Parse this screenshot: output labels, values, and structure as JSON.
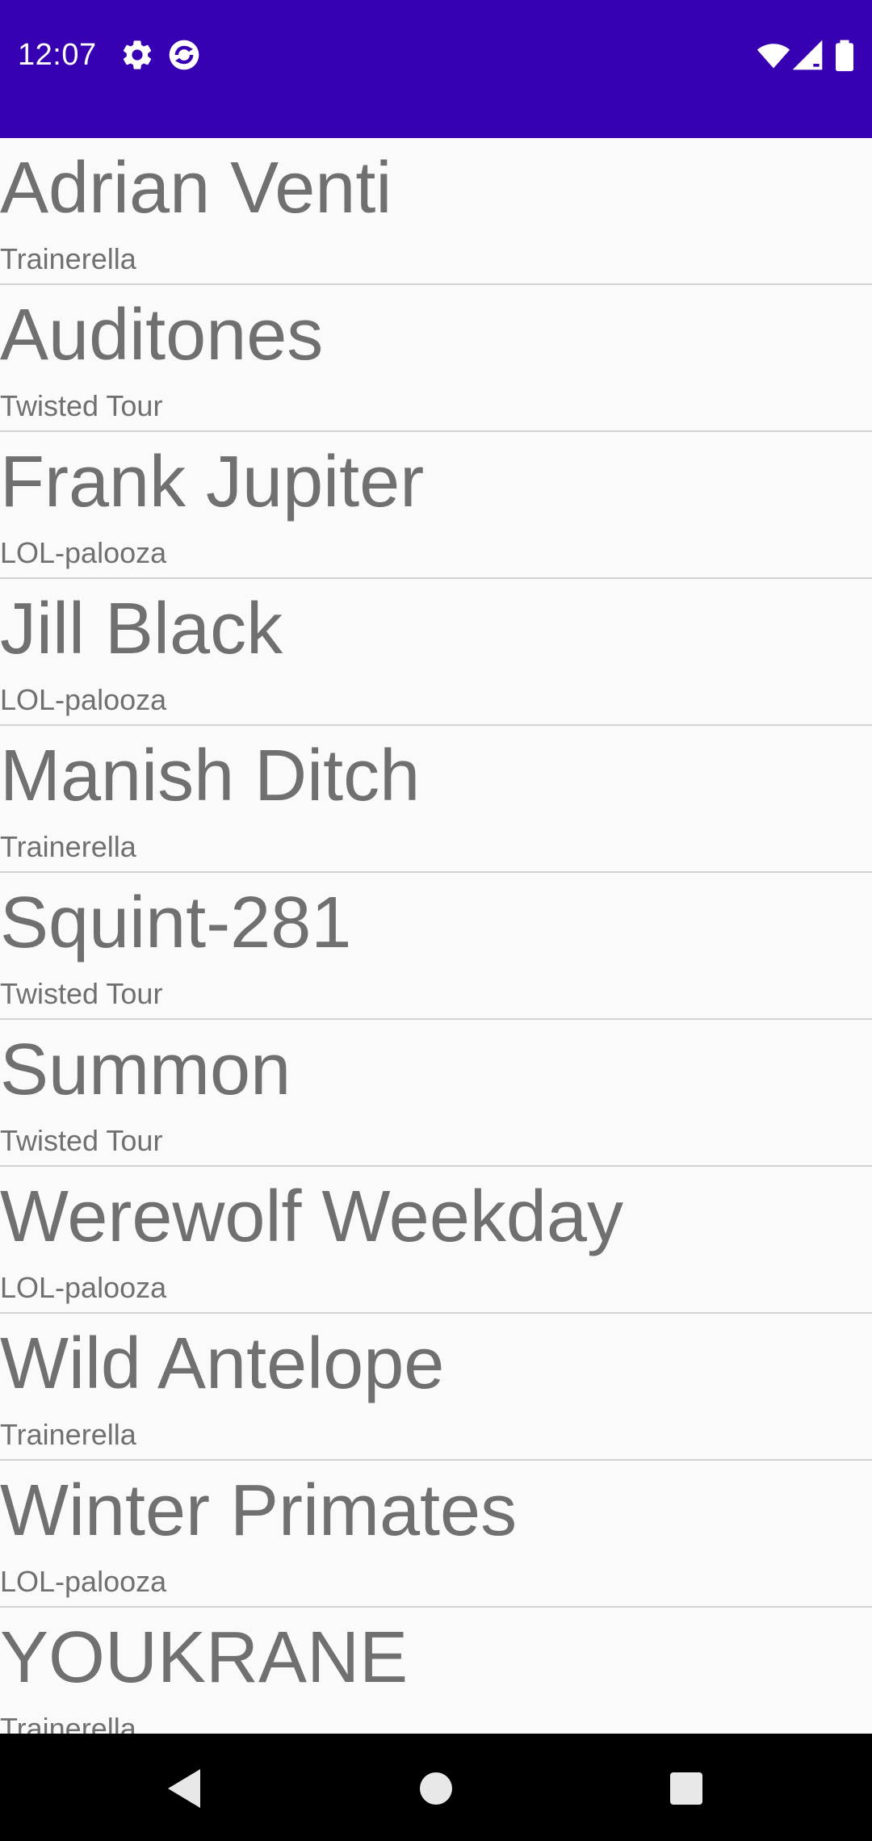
{
  "status_bar": {
    "time": "12:07",
    "background": "#3700b3",
    "icons": [
      "settings-gear-icon",
      "sync-app-icon",
      "wifi-icon",
      "cell-signal-icon",
      "battery-icon"
    ]
  },
  "list": {
    "items": [
      {
        "title": "Adrian Venti",
        "subtitle": "Trainerella"
      },
      {
        "title": "Auditones",
        "subtitle": "Twisted Tour"
      },
      {
        "title": "Frank Jupiter",
        "subtitle": "LOL-palooza"
      },
      {
        "title": "Jill Black",
        "subtitle": "LOL-palooza"
      },
      {
        "title": "Manish Ditch",
        "subtitle": "Trainerella"
      },
      {
        "title": "Squint-281",
        "subtitle": "Twisted Tour"
      },
      {
        "title": "Summon",
        "subtitle": "Twisted Tour"
      },
      {
        "title": "Werewolf Weekday",
        "subtitle": "LOL-palooza"
      },
      {
        "title": "Wild Antelope",
        "subtitle": "Trainerella"
      },
      {
        "title": "Winter Primates",
        "subtitle": "LOL-palooza"
      },
      {
        "title": "YOUKRANE",
        "subtitle": "Trainerella"
      }
    ]
  },
  "nav_bar": {
    "buttons": [
      "back-icon",
      "home-icon",
      "recents-icon"
    ]
  }
}
